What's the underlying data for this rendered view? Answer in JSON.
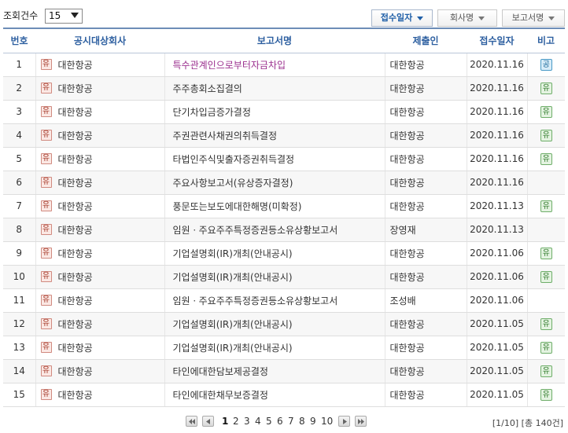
{
  "toolbar": {
    "count_label": "조회건수",
    "count_value": "15",
    "sort_buttons": [
      {
        "label": "접수일자",
        "active": true
      },
      {
        "label": "회사명",
        "active": false
      },
      {
        "label": "보고서명",
        "active": false
      }
    ]
  },
  "table": {
    "headers": [
      "번호",
      "공시대상회사",
      "보고서명",
      "제출인",
      "접수일자",
      "비고"
    ],
    "rows": [
      {
        "num": "1",
        "market": "유",
        "corp": "대한항공",
        "title": "특수관계인으로부터자금차입",
        "highlight": true,
        "submitter": "대한항공",
        "date": "2020.11.16",
        "note": "공"
      },
      {
        "num": "2",
        "market": "유",
        "corp": "대한항공",
        "title": "주주총회소집결의",
        "highlight": false,
        "submitter": "대한항공",
        "date": "2020.11.16",
        "note": "유"
      },
      {
        "num": "3",
        "market": "유",
        "corp": "대한항공",
        "title": "단기차입금증가결정",
        "highlight": false,
        "submitter": "대한항공",
        "date": "2020.11.16",
        "note": "유"
      },
      {
        "num": "4",
        "market": "유",
        "corp": "대한항공",
        "title": "주권관련사채권의취득결정",
        "highlight": false,
        "submitter": "대한항공",
        "date": "2020.11.16",
        "note": "유"
      },
      {
        "num": "5",
        "market": "유",
        "corp": "대한항공",
        "title": "타법인주식및출자증권취득결정",
        "highlight": false,
        "submitter": "대한항공",
        "date": "2020.11.16",
        "note": "유"
      },
      {
        "num": "6",
        "market": "유",
        "corp": "대한항공",
        "title": "주요사항보고서(유상증자결정)",
        "highlight": false,
        "submitter": "대한항공",
        "date": "2020.11.16",
        "note": ""
      },
      {
        "num": "7",
        "market": "유",
        "corp": "대한항공",
        "title": "풍문또는보도에대한해명(미확정)",
        "highlight": false,
        "submitter": "대한항공",
        "date": "2020.11.13",
        "note": "유"
      },
      {
        "num": "8",
        "market": "유",
        "corp": "대한항공",
        "title": "임원ㆍ주요주주특정증권등소유상황보고서",
        "highlight": false,
        "submitter": "장영재",
        "date": "2020.11.13",
        "note": ""
      },
      {
        "num": "9",
        "market": "유",
        "corp": "대한항공",
        "title": "기업설명회(IR)개최(안내공시)",
        "highlight": false,
        "submitter": "대한항공",
        "date": "2020.11.06",
        "note": "유"
      },
      {
        "num": "10",
        "market": "유",
        "corp": "대한항공",
        "title": "기업설명회(IR)개최(안내공시)",
        "highlight": false,
        "submitter": "대한항공",
        "date": "2020.11.06",
        "note": "유"
      },
      {
        "num": "11",
        "market": "유",
        "corp": "대한항공",
        "title": "임원ㆍ주요주주특정증권등소유상황보고서",
        "highlight": false,
        "submitter": "조성배",
        "date": "2020.11.06",
        "note": ""
      },
      {
        "num": "12",
        "market": "유",
        "corp": "대한항공",
        "title": "기업설명회(IR)개최(안내공시)",
        "highlight": false,
        "submitter": "대한항공",
        "date": "2020.11.05",
        "note": "유"
      },
      {
        "num": "13",
        "market": "유",
        "corp": "대한항공",
        "title": "기업설명회(IR)개최(안내공시)",
        "highlight": false,
        "submitter": "대한항공",
        "date": "2020.11.05",
        "note": "유"
      },
      {
        "num": "14",
        "market": "유",
        "corp": "대한항공",
        "title": "타인에대한담보제공결정",
        "highlight": false,
        "submitter": "대한항공",
        "date": "2020.11.05",
        "note": "유"
      },
      {
        "num": "15",
        "market": "유",
        "corp": "대한항공",
        "title": "타인에대한채무보증결정",
        "highlight": false,
        "submitter": "대한항공",
        "date": "2020.11.05",
        "note": "유"
      }
    ]
  },
  "pagination": {
    "pages": [
      "1",
      "2",
      "3",
      "4",
      "5",
      "6",
      "7",
      "8",
      "9",
      "10"
    ],
    "current": "1",
    "nav_icons": [
      "first-page-icon",
      "prev-page-icon",
      "next-page-icon",
      "last-page-icon"
    ],
    "info": "[1/10] [총 140건]"
  },
  "colors": {
    "header_text": "#2d5fa0",
    "highlight_title": "#9b2f8e",
    "market_badge": "#a03020",
    "note_yu": "#2f7a2a",
    "note_gong": "#1d6a9a"
  }
}
